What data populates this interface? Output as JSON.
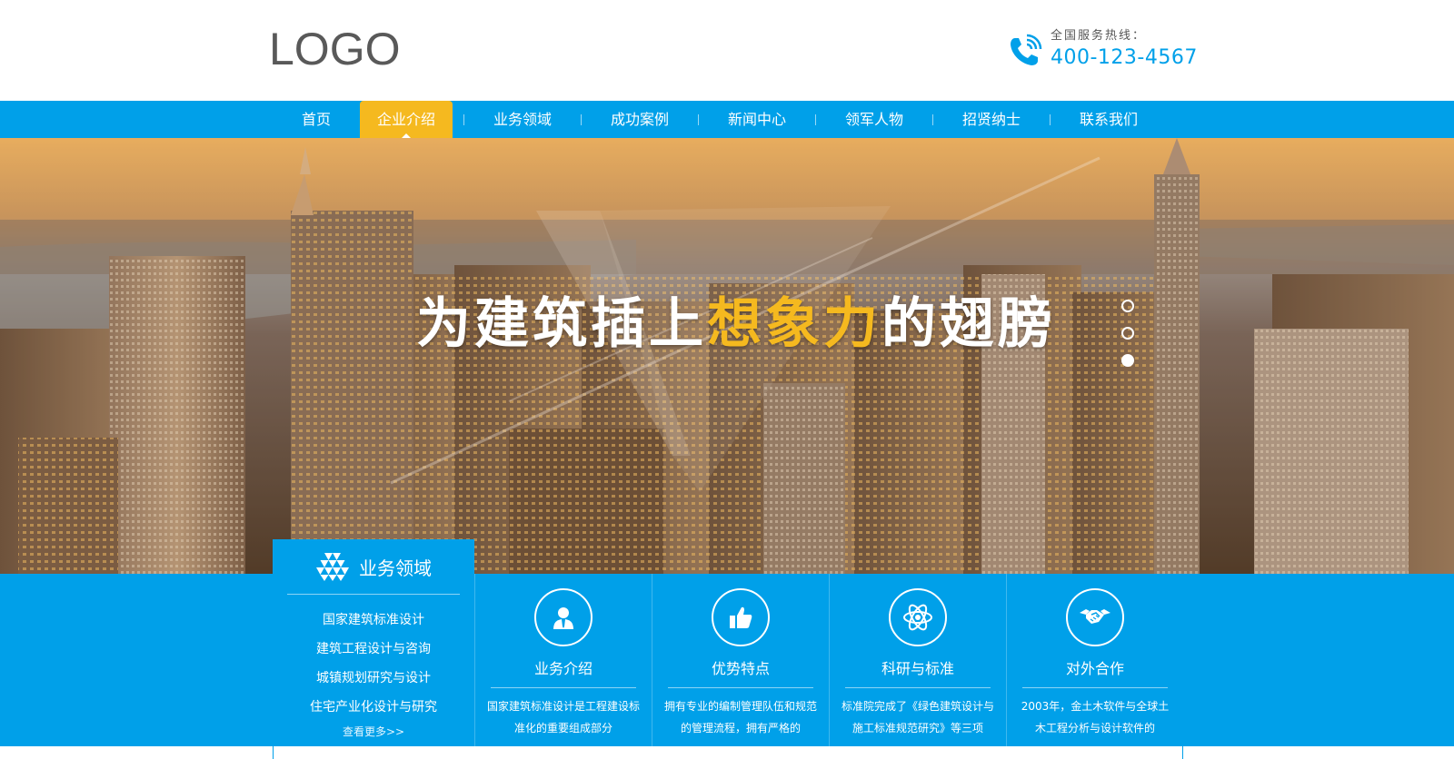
{
  "header": {
    "logo": "LOGO",
    "hotline_label": "全国服务热线：",
    "hotline_number": "400-123-4567"
  },
  "nav": {
    "items": [
      {
        "label": "首页"
      },
      {
        "label": "企业介绍",
        "active": true
      },
      {
        "label": "业务领域"
      },
      {
        "label": "成功案例"
      },
      {
        "label": "新闻中心"
      },
      {
        "label": "领军人物"
      },
      {
        "label": "招贤纳士"
      },
      {
        "label": "联系我们"
      }
    ],
    "active_color": "#f5b91f",
    "bar_color": "#00a0e9"
  },
  "banner": {
    "slogan_part1": "为建筑插上",
    "slogan_highlight": "想象力",
    "slogan_part2": "的翅膀",
    "slide_count": 3,
    "active_slide": 3
  },
  "business_panel": {
    "title": "业务领域",
    "icon": "triangles-icon",
    "links": [
      "国家建筑标准设计",
      "建筑工程设计与咨询",
      "城镇规划研究与设计",
      "住宅产业化设计与研究"
    ],
    "more": "查看更多>>"
  },
  "cards": [
    {
      "icon": "person-icon",
      "title": "业务介绍",
      "desc": "国家建筑标准设计是工程建设标准化的重要组成部分"
    },
    {
      "icon": "thumbs-up-icon",
      "title": "优势特点",
      "desc": "拥有专业的编制管理队伍和规范的管理流程，拥有严格的"
    },
    {
      "icon": "atom-icon",
      "title": "科研与标准",
      "desc": "标准院完成了《绿色建筑设计与施工标准规范研究》等三项"
    },
    {
      "icon": "handshake-icon",
      "title": "对外合作",
      "desc": "2003年，金土木软件与全球土木工程分析与设计软件的"
    }
  ],
  "colors": {
    "primary": "#00a0e9",
    "accent": "#f5b91f"
  }
}
